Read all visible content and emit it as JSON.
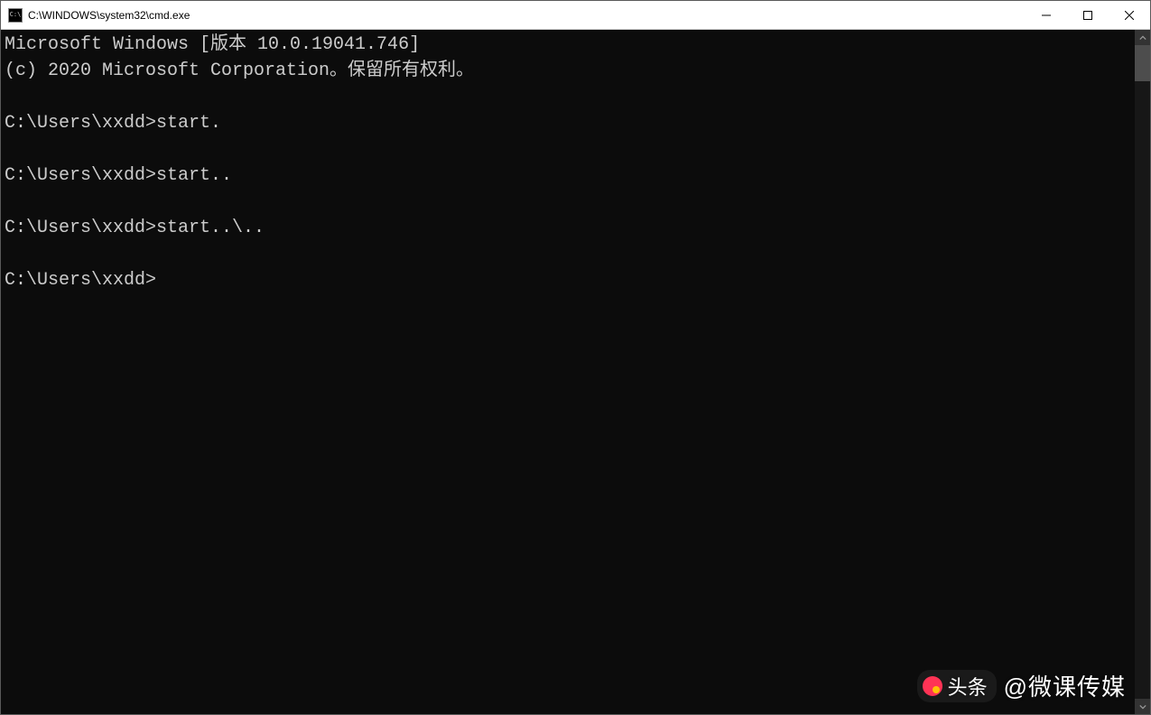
{
  "titlebar": {
    "title": "C:\\WINDOWS\\system32\\cmd.exe"
  },
  "terminal": {
    "lines": [
      "Microsoft Windows [版本 10.0.19041.746]",
      "(c) 2020 Microsoft Corporation。保留所有权利。",
      "",
      "C:\\Users\\xxdd>start.",
      "",
      "C:\\Users\\xxdd>start..",
      "",
      "C:\\Users\\xxdd>start..\\..",
      "",
      "C:\\Users\\xxdd>"
    ]
  },
  "watermark": {
    "brand": "头条",
    "handle": "@微课传媒"
  }
}
